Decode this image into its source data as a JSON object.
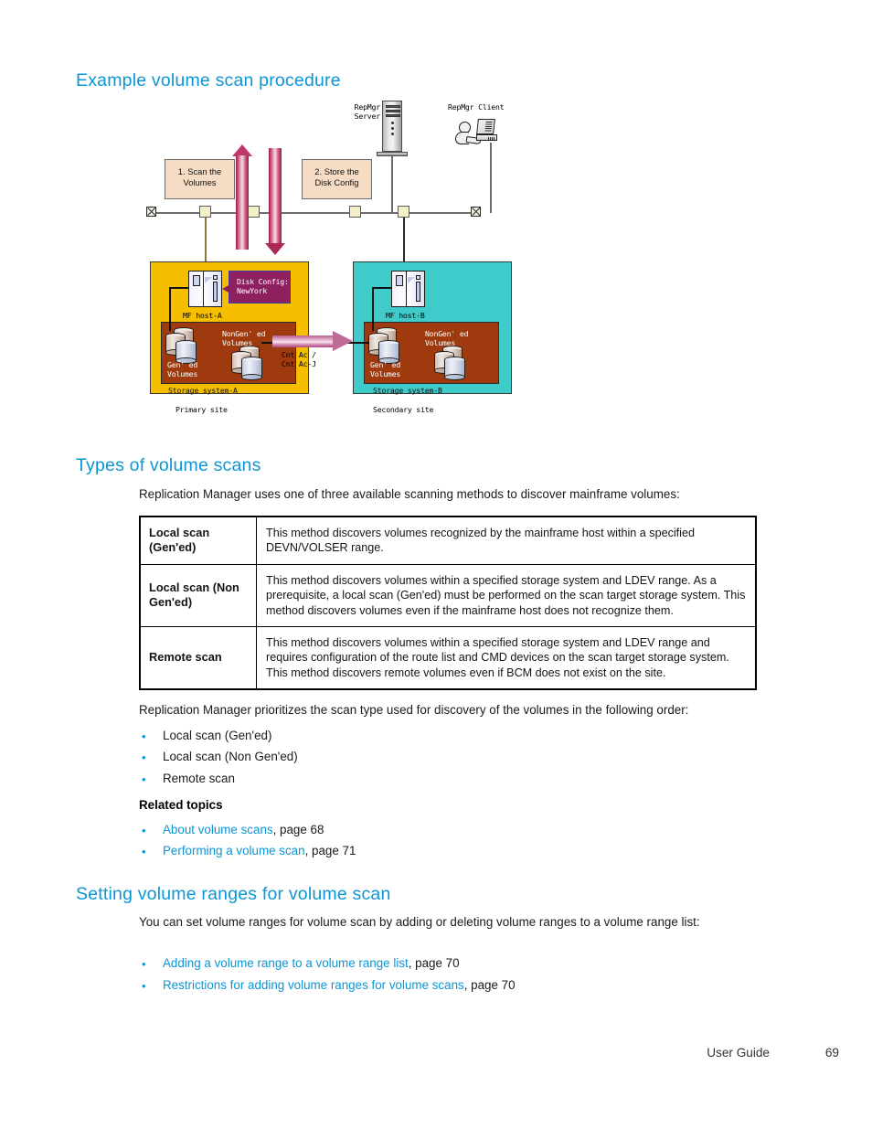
{
  "page": {
    "footer_label": "User Guide",
    "page_number": "69"
  },
  "sections": {
    "example": {
      "title": "Example volume scan procedure"
    },
    "types": {
      "title": "Types of volume scans",
      "intro": "Replication Manager uses one of three available scanning methods to discover mainframe volumes:",
      "table": {
        "rows": [
          {
            "name": "Local scan (Gen'ed)",
            "name_line1": "Local scan",
            "name_line2": "(Gen'ed)",
            "description": "This method discovers volumes recognized by the mainframe host within a specified DEVN/VOLSER range."
          },
          {
            "name": "Local scan (Non Gen'ed)",
            "name_line1": "Local scan (Non",
            "name_line2": "Gen'ed)",
            "description": "This method discovers volumes within a specified storage system and LDEV range. As a prerequisite, a local scan (Gen'ed) must be performed on the scan target storage system. This method discovers volumes even if the mainframe host does not recognize them."
          },
          {
            "name": "Remote scan",
            "name_line1": "Remote scan",
            "name_line2": "",
            "description": "This method discovers volumes within a specified storage system and LDEV range and requires configuration of the route list and CMD devices on the scan target storage system. This method discovers remote volumes even if BCM does not exist on the site."
          }
        ]
      },
      "priority_intro": "Replication Manager prioritizes the scan type used for discovery of the volumes in the following order:",
      "priority_items": [
        "Local scan (Gen'ed)",
        "Local scan (Non Gen'ed)",
        "Remote scan"
      ],
      "related_topics_label": "Related topics",
      "related_topics": [
        {
          "link": "About volume scans",
          "suffix": ", page 68"
        },
        {
          "link": "Performing a volume scan",
          "suffix": ", page 71"
        }
      ]
    },
    "ranges": {
      "title": "Setting volume ranges for volume scan",
      "intro": "You can set volume ranges for volume scan by adding or deleting volume ranges to a volume range list:",
      "links": [
        {
          "link": "Adding a volume range to a volume range list",
          "suffix": ", page 70"
        },
        {
          "link": "Restrictions for adding volume ranges for volume scans",
          "suffix": ", page 70"
        }
      ]
    }
  },
  "diagram": {
    "server_label_line1": "RepMgr",
    "server_label_line2": "Server",
    "client_label": "RepMgr Client",
    "step1_line1": "1. Scan the",
    "step1_line2": "Volumes",
    "step2_line1": "2. Store the",
    "step2_line2": "Disk Config",
    "bubble_line1": "Disk Config:",
    "bubble_line2": "NewYork",
    "primary": {
      "host_label": "MF host-A",
      "nongened_line1": "NonGen' ed",
      "nongened_line2": "Volumes",
      "gened_line1": "Gen' ed",
      "gened_line2": "Volumes",
      "storage_label": "Storage system-A",
      "site_label": "Primary site"
    },
    "secondary": {
      "host_label": "MF host-B",
      "nongened_line1": "NonGen' ed",
      "nongened_line2": "Volumes",
      "gened_line1": "Gen' ed",
      "gened_line2": "Volumes",
      "storage_label": "Storage system-B",
      "site_label": "Secondary site"
    },
    "link_label_line1": "Cnt Ac /",
    "link_label_line2": "Cnt Ac-J"
  },
  "colors": {
    "heading": "#0b96d5",
    "link": "#0b96d5",
    "primary_site": "#f5bf00",
    "secondary_site": "#3fcbc9",
    "storage_box": "#9e3a0d",
    "callout": "#f6dcc4",
    "bubble": "#8f2060"
  }
}
